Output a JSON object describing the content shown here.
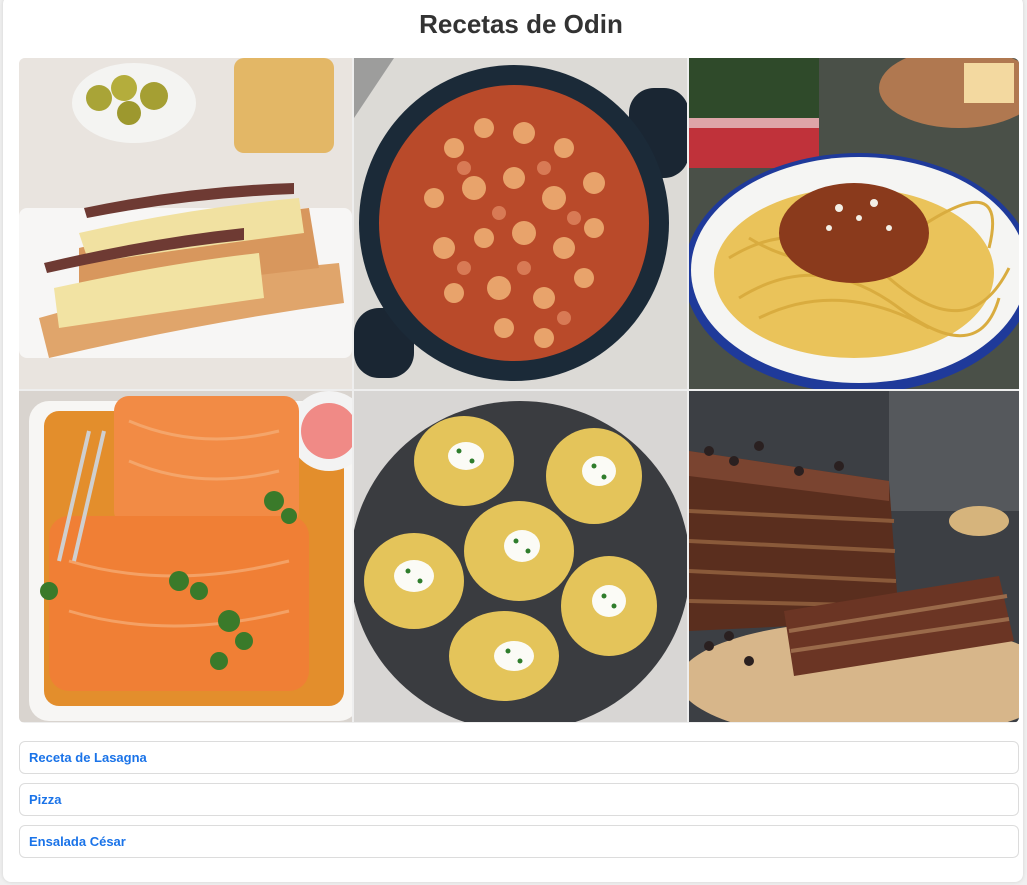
{
  "page": {
    "title": "Recetas de Odin"
  },
  "gallery": {
    "images": [
      {
        "name": "anchovy-salad-bread-image",
        "subject": "bread rolls topped with salad and anchovies"
      },
      {
        "name": "octopus-chickpea-stew-image",
        "subject": "octopus and chickpea stew in black pan"
      },
      {
        "name": "spaghetti-bolognese-image",
        "subject": "spaghetti with bolognese sauce"
      },
      {
        "name": "glazed-salmon-image",
        "subject": "glazed salmon fillets with parsley"
      },
      {
        "name": "smashed-potatoes-image",
        "subject": "smashed potatoes with sour cream and chives"
      },
      {
        "name": "chocolate-biscuit-cake-image",
        "subject": "chocolate biscuit layered cake"
      }
    ]
  },
  "links": [
    {
      "label": "Receta de Lasagna"
    },
    {
      "label": "Pizza"
    },
    {
      "label": "Ensalada César"
    }
  ],
  "colors": {
    "link": "#1a73e8",
    "title": "#333333",
    "border": "#dcdcdc"
  }
}
